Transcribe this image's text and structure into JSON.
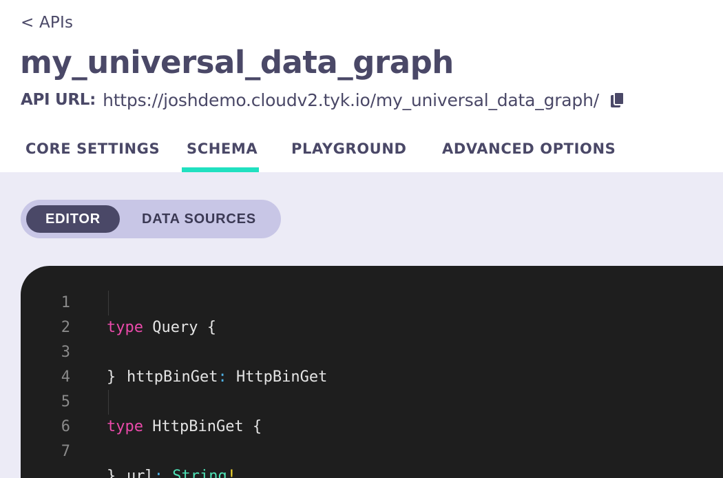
{
  "header": {
    "back_link": "< APIs",
    "title": "my_universal_data_graph",
    "api_url_label": "API URL:",
    "api_url_value": "https://joshdemo.cloudv2.tyk.io/my_universal_data_graph/"
  },
  "tabs": [
    {
      "label": "CORE SETTINGS",
      "active": false
    },
    {
      "label": "SCHEMA",
      "active": true
    },
    {
      "label": "PLAYGROUND",
      "active": false
    },
    {
      "label": "ADVANCED OPTIONS",
      "active": false
    }
  ],
  "toggle": {
    "editor_label": "EDITOR",
    "data_sources_label": "DATA SOURCES",
    "selected": "EDITOR"
  },
  "editor": {
    "line_numbers": [
      "1",
      "2",
      "3",
      "4",
      "5",
      "6",
      "7"
    ],
    "lines": [
      {
        "kw": "type",
        "rest": " Query {"
      },
      {
        "field": "httpBinGet",
        "colon": ":",
        "type": " HttpBinGet"
      },
      {
        "text": "}"
      },
      {
        "text": ""
      },
      {
        "kw": "type",
        "rest": " HttpBinGet {"
      },
      {
        "field": "url",
        "colon": ":",
        "type": " String",
        "bang": "!"
      },
      {
        "text": "}"
      }
    ]
  },
  "colors": {
    "accent": "#20e0c0",
    "title_text": "#4a4867",
    "content_bg": "#ecebf6",
    "toggle_bg": "#c8c6e6",
    "editor_bg": "#1e1e1e",
    "keyword": "#ea4aaa",
    "scalar_type": "#4ee0b4"
  },
  "icons": {
    "copy": "copy-icon"
  }
}
